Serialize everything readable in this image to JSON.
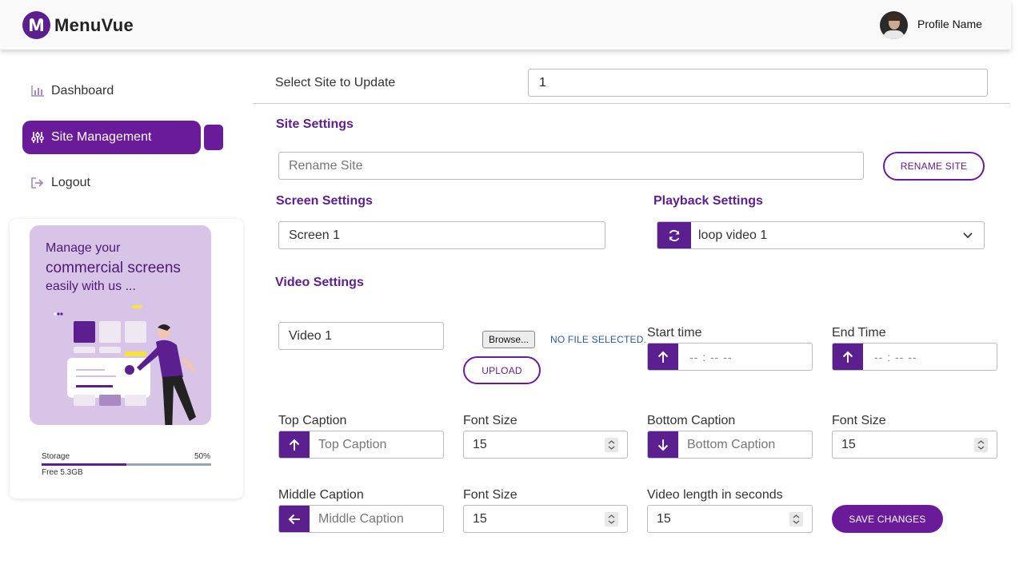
{
  "app": {
    "brand": "MenuVue"
  },
  "header": {
    "profile_name": "Profile Name"
  },
  "sidebar": {
    "items": [
      {
        "label": "Dashboard",
        "icon": "bar-chart-icon"
      },
      {
        "label": "Site Management",
        "icon": "sliders-icon",
        "active": true
      },
      {
        "label": "Logout",
        "icon": "logout-icon"
      }
    ],
    "promo": {
      "line1": "Manage your",
      "line2": "commercial screens",
      "line3": "easily with us ..."
    },
    "storage": {
      "label": "Storage",
      "percent_text": "50%",
      "percent": 50,
      "free": "Free 5.3GB"
    }
  },
  "site_select": {
    "label": "Select Site to Update",
    "value": "1"
  },
  "site_settings": {
    "heading": "Site Settings",
    "rename_placeholder": "Rename Site",
    "rename_button": "RENAME SITE"
  },
  "screen_settings": {
    "heading": "Screen Settings",
    "value": "Screen 1"
  },
  "playback_settings": {
    "heading": "Playback Settings",
    "value": "loop video 1",
    "icon": "refresh-icon"
  },
  "video_settings": {
    "heading": "Video Settings",
    "video_name": "Video 1",
    "browse_label": "Browse...",
    "file_status": "NO FILE SELECTED.",
    "upload_button": "UPLOAD",
    "start_time_label": "Start time",
    "start_time_placeholder": "-- : --   --",
    "end_time_label": "End Time",
    "end_time_placeholder": "-- : --   --",
    "top_caption_label": "Top Caption",
    "top_caption_placeholder": "Top Caption",
    "top_font_label": "Font Size",
    "top_font_value": "15",
    "bottom_caption_label": "Bottom Caption",
    "bottom_caption_placeholder": "Bottom Caption",
    "bottom_font_label": "Font Size",
    "bottom_font_value": "15",
    "middle_caption_label": "Middle Caption",
    "middle_caption_placeholder": "Middle Caption",
    "middle_font_label": "Font Size",
    "middle_font_value": "15",
    "length_label": "Video length in seconds",
    "length_value": "15",
    "save_button": "SAVE CHANGES"
  },
  "colors": {
    "accent": "#6a1b9a",
    "accent_dark": "#5b1f8f",
    "promo_bg": "#d8c4e6",
    "link": "#2c5aa0"
  }
}
